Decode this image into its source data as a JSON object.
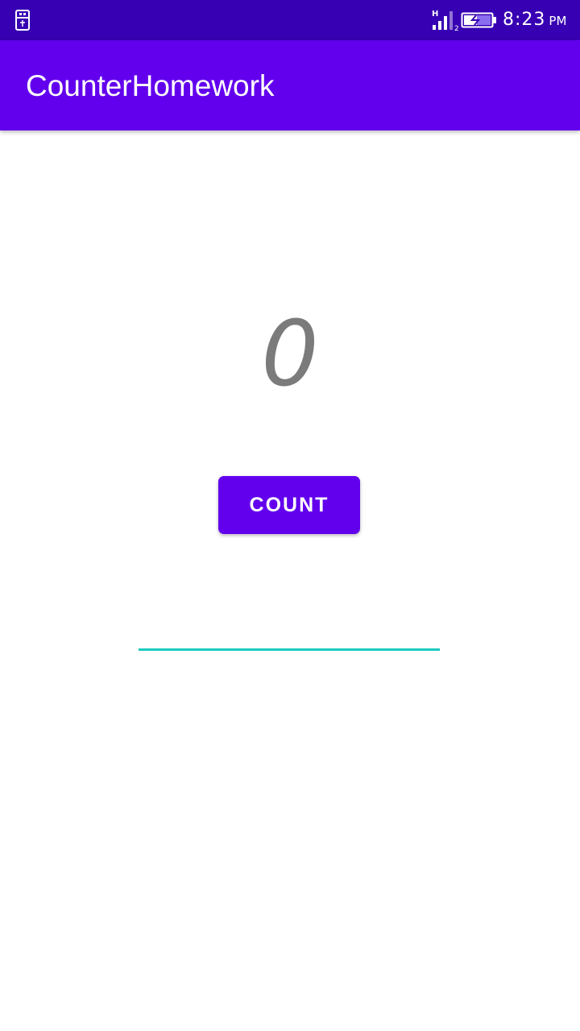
{
  "status_bar": {
    "time": "8:23",
    "ampm": "PM",
    "network_type": "H",
    "sim_slot": "2",
    "icons": [
      "usb-icon",
      "signal-icon",
      "battery-icon"
    ],
    "background_color": "#3700b3"
  },
  "app_bar": {
    "title": "CounterHomework",
    "background_color": "#6200ee"
  },
  "counter": {
    "value": "0",
    "text_color": "#7b7b7b"
  },
  "count_button": {
    "label": "COUNT",
    "background_color": "#6200ee"
  },
  "input": {
    "value": "",
    "underline_color": "#1bcbc1"
  }
}
